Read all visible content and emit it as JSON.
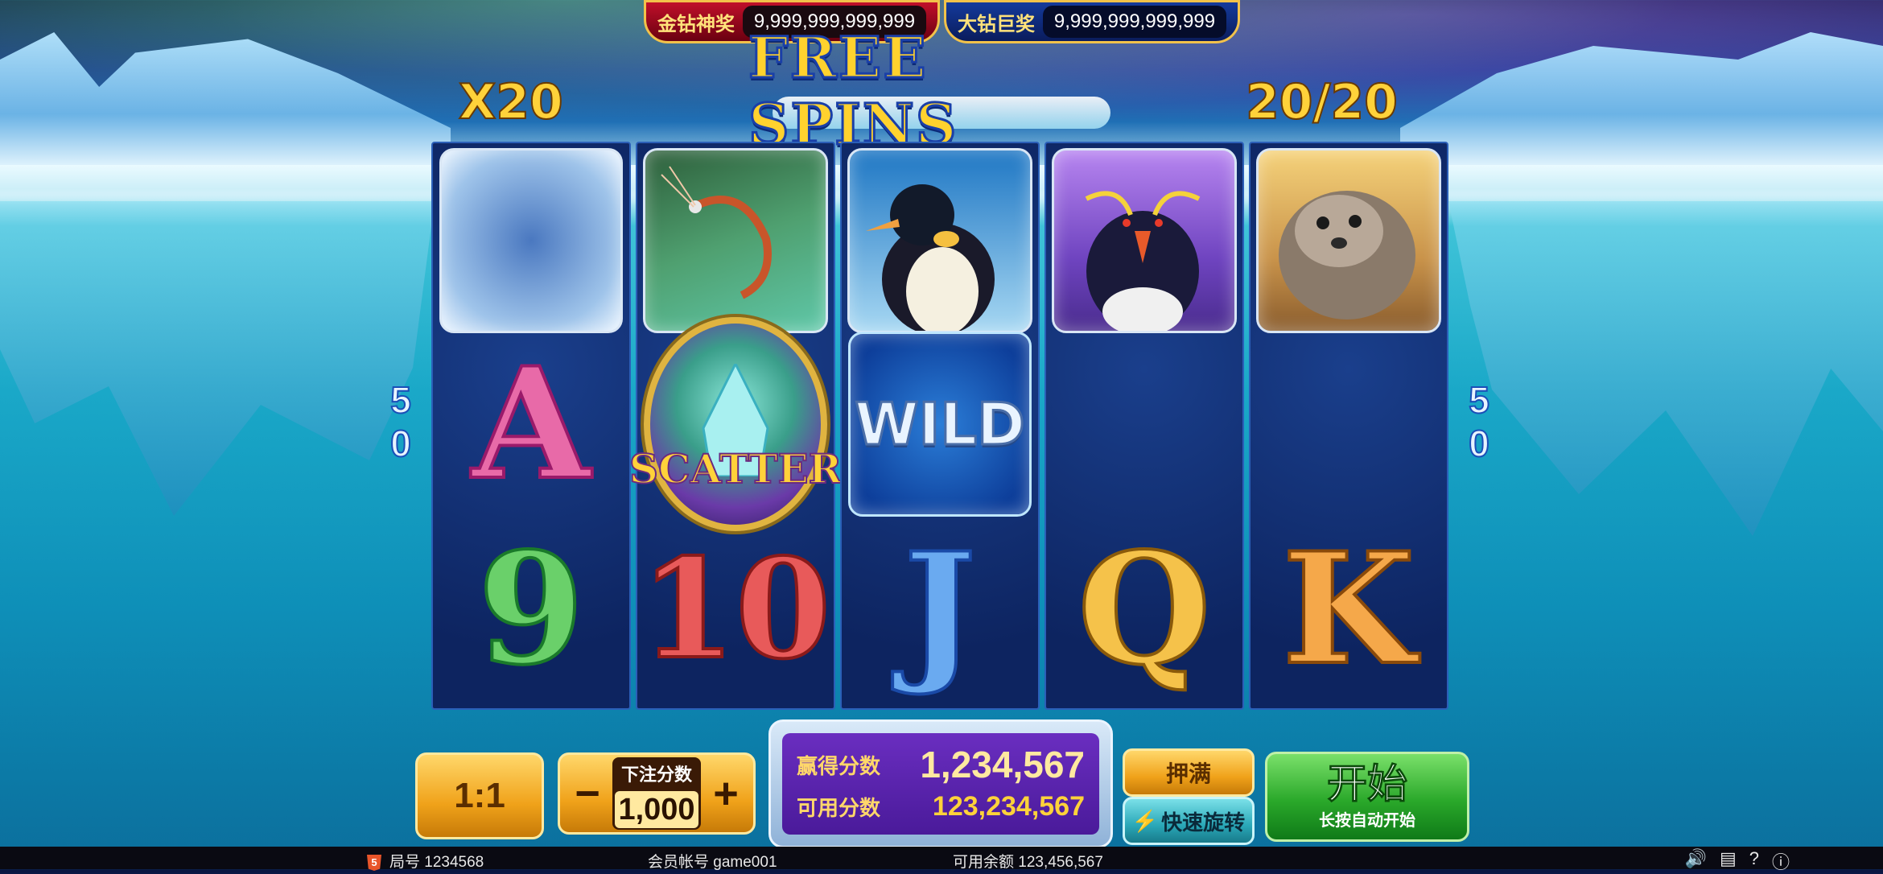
{
  "jackpots": [
    {
      "label": "金钻神奖",
      "value": "9,999,999,999,999"
    },
    {
      "label": "大钻巨奖",
      "value": "9,999,999,999,999"
    }
  ],
  "banner": "FREE SPINS",
  "multiplier": "X20",
  "spin_count": "20/20",
  "lines_left": [
    "5",
    "0"
  ],
  "lines_right": [
    "5",
    "0"
  ],
  "reels": [
    [
      "ice-block",
      "A",
      "9"
    ],
    [
      "shrimp",
      "SCATTER",
      "10"
    ],
    [
      "emperor-penguin",
      "WILD",
      "J"
    ],
    [
      "rockhopper-penguin",
      "",
      "Q"
    ],
    [
      "seal",
      "",
      "K"
    ]
  ],
  "symbols": {
    "scatter": "SCATTER",
    "wild": "WILD",
    "A": "A",
    "9": "9",
    "10": "10",
    "J": "J",
    "Q": "Q",
    "K": "K"
  },
  "controls": {
    "ratio": "1:1",
    "bet_label": "下注分数",
    "bet_value": "1,000",
    "minus": "−",
    "plus": "+",
    "win_label": "赢得分数",
    "win_value": "1,234,567",
    "credit_label": "可用分数",
    "credit_value": "123,234,567",
    "max_bet": "押满",
    "quick_spin": "快速旋转",
    "start": "开始",
    "start_sub": "长按自动开始"
  },
  "status": {
    "round": "局号 1234568",
    "account": "会员帐号  game001",
    "balance": "可用余额  123,456,567",
    "html5": "5"
  },
  "icons": [
    "sound-icon",
    "history-icon",
    "help-icon",
    "info-icon"
  ]
}
